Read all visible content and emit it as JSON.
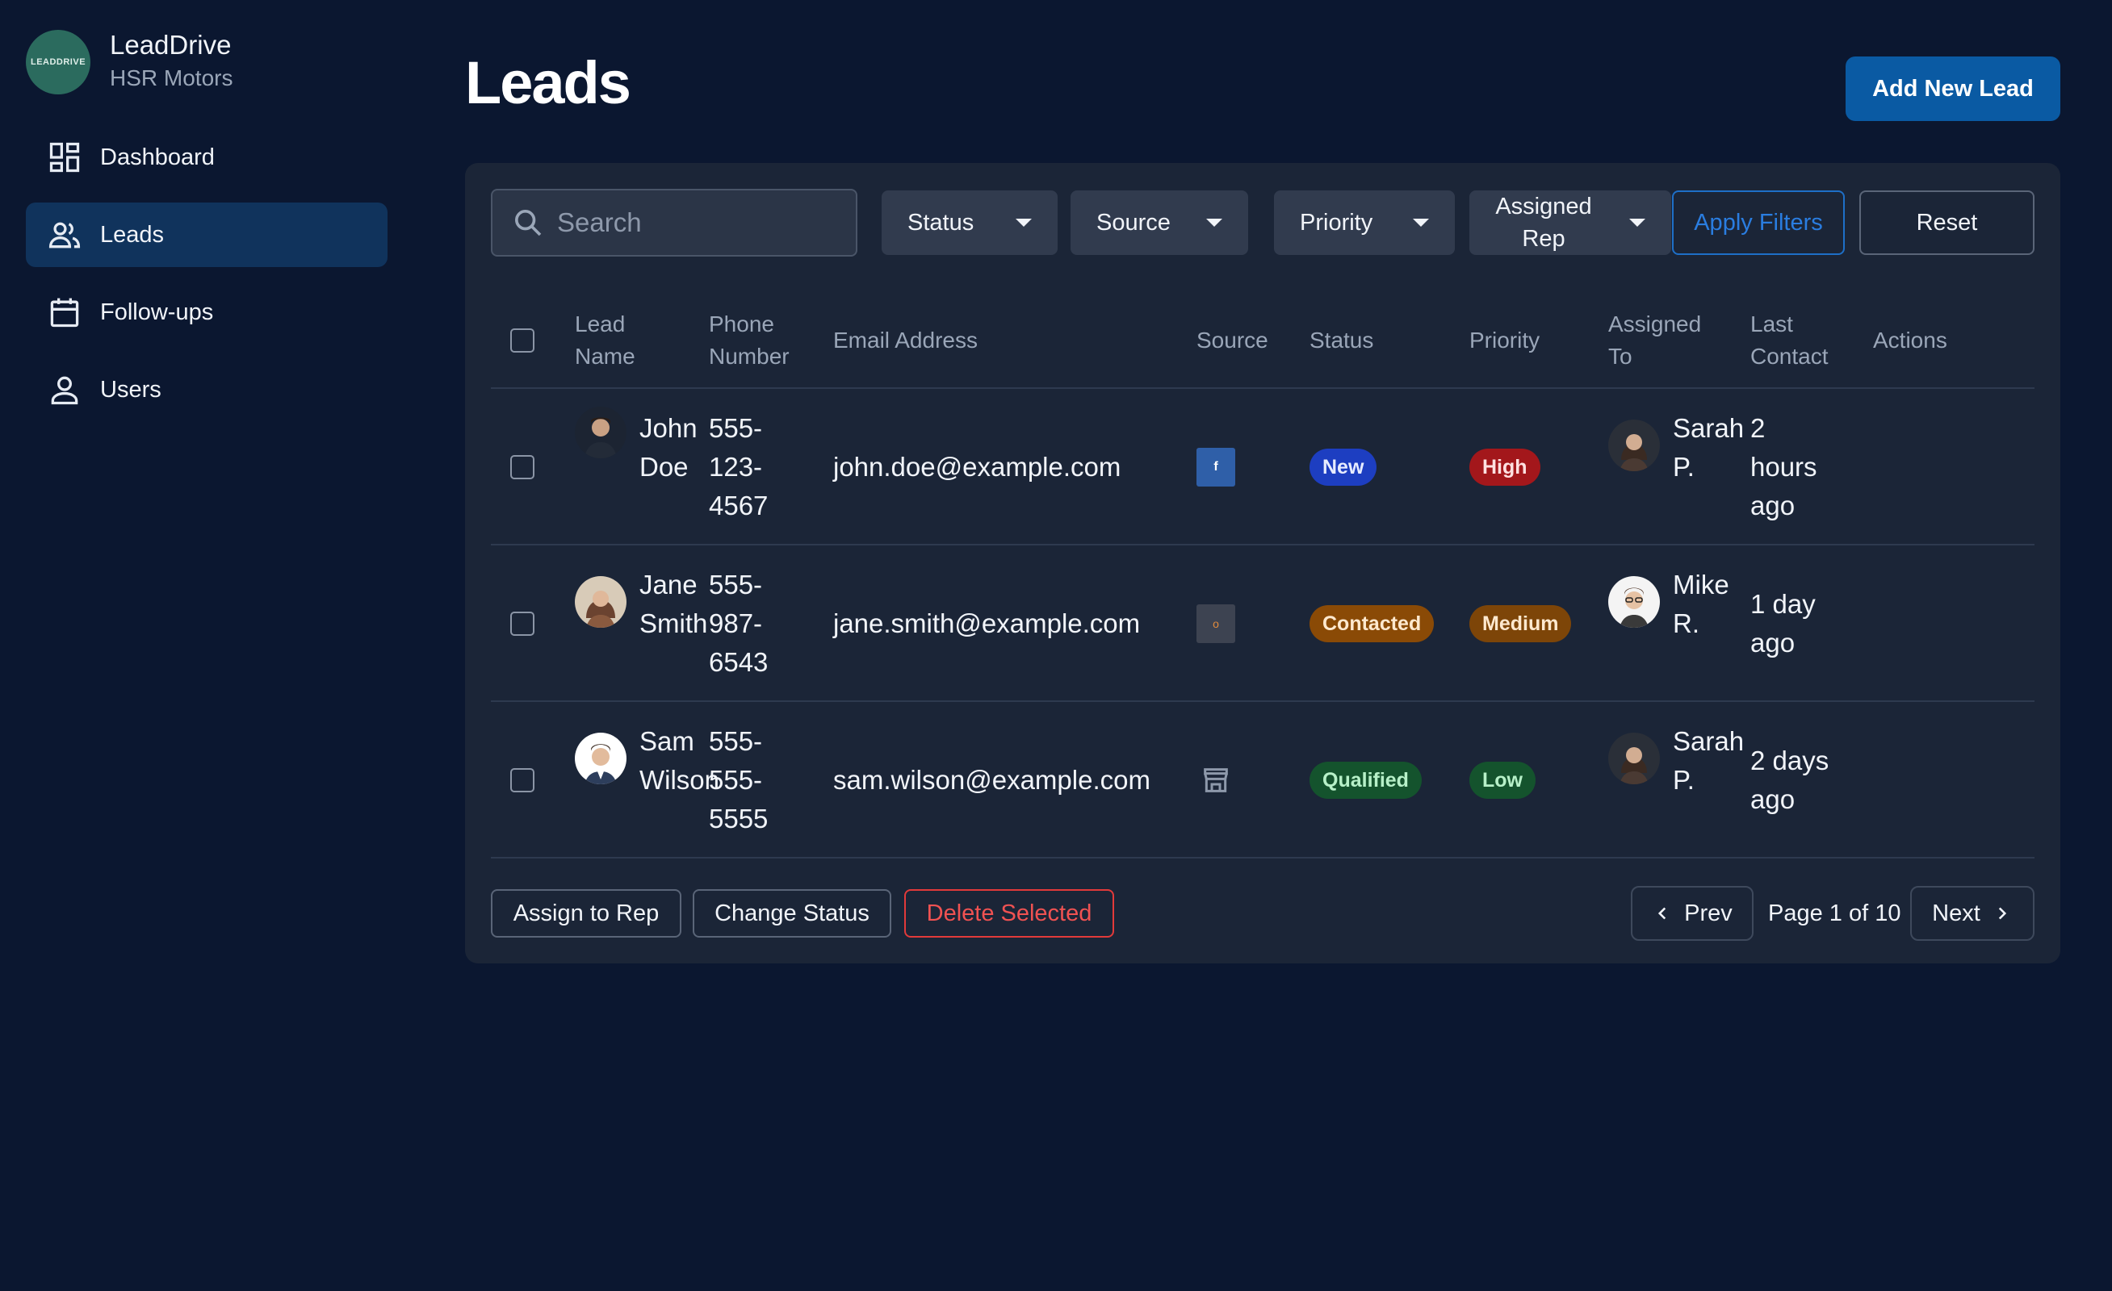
{
  "brand": {
    "logo_text": "LEADDRIVE",
    "name": "LeadDrive",
    "subtitle": "HSR Motors"
  },
  "sidebar": {
    "items": [
      {
        "label": "Dashboard",
        "icon": "dashboard-icon"
      },
      {
        "label": "Leads",
        "icon": "people-icon",
        "active": true
      },
      {
        "label": "Follow-ups",
        "icon": "calendar-icon"
      },
      {
        "label": "Users",
        "icon": "user-icon"
      }
    ]
  },
  "header": {
    "title": "Leads",
    "add_button": "Add New Lead"
  },
  "filters": {
    "search_placeholder": "Search",
    "status": "Status",
    "source": "Source",
    "priority": "Priority",
    "assigned_rep_line1": "Assigned",
    "assigned_rep_line2": "Rep",
    "apply": "Apply Filters",
    "reset": "Reset"
  },
  "table": {
    "columns": {
      "lead_name_1": "Lead",
      "lead_name_2": "Name",
      "phone_1": "Phone",
      "phone_2": "Number",
      "email": "Email Address",
      "source": "Source",
      "status": "Status",
      "priority": "Priority",
      "assigned_1": "Assigned",
      "assigned_2": "To",
      "last_1": "Last",
      "last_2": "Contact",
      "actions": "Actions"
    },
    "rows": [
      {
        "first": "John",
        "last": "Doe",
        "phone_1": "555-",
        "phone_2": "123-",
        "phone_3": "4567",
        "email": "john.doe@example.com",
        "source_icon": "facebook-icon",
        "source_glyph": "f",
        "status": "New",
        "priority": "High",
        "rep_first": "Sarah",
        "rep_last": "P.",
        "contact_1": "2",
        "contact_2": "hours",
        "contact_3": "ago"
      },
      {
        "first": "Jane",
        "last": "Smith",
        "phone_1": "555-",
        "phone_2": "987-",
        "phone_3": "6543",
        "email": "jane.smith@example.com",
        "source_icon": "website-icon",
        "source_glyph": "o",
        "status": "Contacted",
        "priority": "Medium",
        "rep_first": "Mike",
        "rep_last": "R.",
        "contact_1": "1 day",
        "contact_2": "ago",
        "contact_3": ""
      },
      {
        "first": "Sam",
        "last": "Wilson",
        "phone_1": "555-",
        "phone_2": "555-",
        "phone_3": "5555",
        "email": "sam.wilson@example.com",
        "source_icon": "storefront-icon",
        "source_glyph": "",
        "status": "Qualified",
        "priority": "Low",
        "rep_first": "Sarah",
        "rep_last": "P.",
        "contact_1": "2 days",
        "contact_2": "ago",
        "contact_3": ""
      }
    ]
  },
  "footer": {
    "assign": "Assign to Rep",
    "change_status": "Change Status",
    "delete": "Delete Selected",
    "prev": "Prev",
    "page_info": "Page 1 of 10",
    "next": "Next"
  },
  "colors": {
    "background": "#0b1730",
    "card": "#1b2537",
    "accent": "#0a5aa3",
    "active_nav": "#10335c",
    "danger": "#e23a3a"
  }
}
